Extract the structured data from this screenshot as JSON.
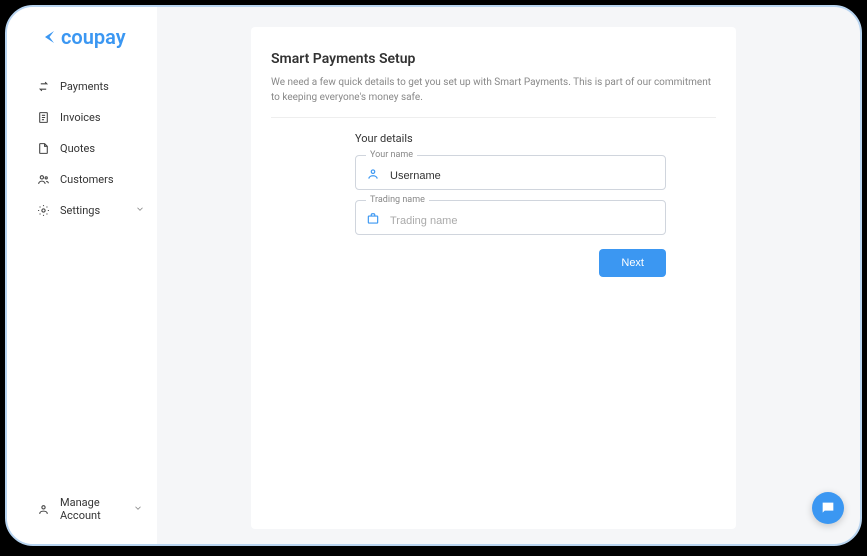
{
  "brand": {
    "name": "coupay"
  },
  "sidebar": {
    "items": [
      {
        "label": "Payments"
      },
      {
        "label": "Invoices"
      },
      {
        "label": "Quotes"
      },
      {
        "label": "Customers"
      },
      {
        "label": "Settings"
      }
    ],
    "manage_label": "Manage Account"
  },
  "setup": {
    "title": "Smart Payments Setup",
    "subtitle": "We need a few quick details to get you set up with Smart Payments. This is part of our commitment to keeping everyone's money safe.",
    "section": "Your details",
    "fields": {
      "name": {
        "label": "Your name",
        "value": "Username"
      },
      "trading": {
        "label": "Trading name",
        "placeholder": "Trading name",
        "value": ""
      }
    },
    "next_label": "Next"
  }
}
